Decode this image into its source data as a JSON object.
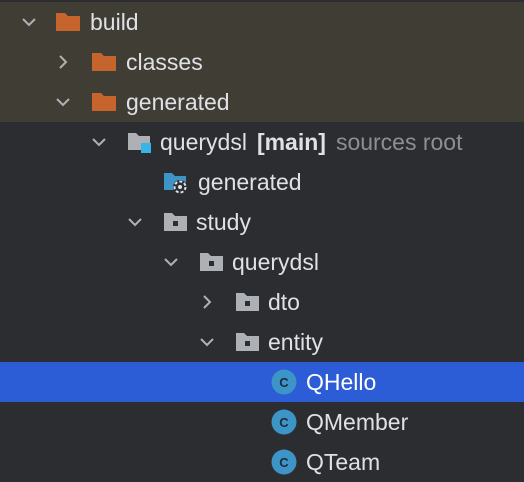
{
  "theme": {
    "background": "#2b2d30",
    "excluded_row_background": "#403d35",
    "selection_background": "#2c5cd6",
    "folder_orange": "#c6642e",
    "folder_gray": "#adb0b5",
    "sources_root_accent": "#3ab4e6",
    "class_icon_color": "#3d95c7",
    "hint_text_color": "#8c8f94"
  },
  "tree": {
    "items": [
      {
        "label": "build",
        "expanded": true,
        "icon": "folder-orange-icon"
      },
      {
        "label": "classes",
        "expanded": false,
        "icon": "folder-orange-icon"
      },
      {
        "label": "generated",
        "expanded": true,
        "icon": "folder-orange-icon"
      },
      {
        "label": "querydsl",
        "badge": "[main]",
        "hint": "sources root",
        "expanded": true,
        "icon": "module-folder-icon"
      },
      {
        "label": "generated",
        "icon": "generated-sources-folder-icon"
      },
      {
        "label": "study",
        "expanded": true,
        "icon": "package-folder-icon"
      },
      {
        "label": "querydsl",
        "expanded": true,
        "icon": "package-folder-icon"
      },
      {
        "label": "dto",
        "expanded": false,
        "icon": "package-folder-icon"
      },
      {
        "label": "entity",
        "expanded": true,
        "icon": "package-folder-icon"
      },
      {
        "label": "QHello",
        "selected": true,
        "icon": "class-icon",
        "icon_letter": "C"
      },
      {
        "label": "QMember",
        "icon": "class-icon",
        "icon_letter": "C"
      },
      {
        "label": "QTeam",
        "icon": "class-icon",
        "icon_letter": "C"
      }
    ]
  }
}
